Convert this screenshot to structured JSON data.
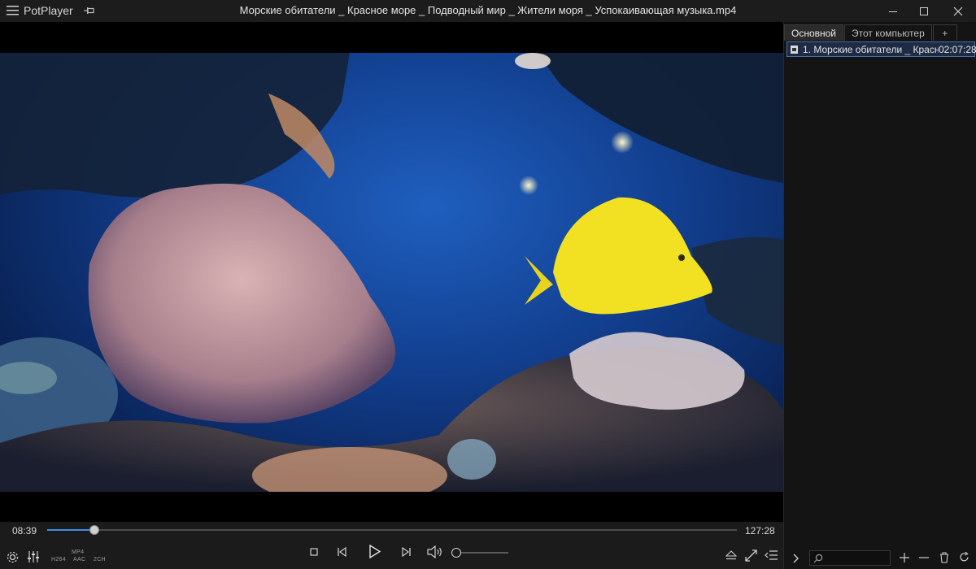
{
  "app": {
    "name": "PotPlayer",
    "title": "Морские обитатели _ Красное море _ Подводный мир _ Жители моря _ Успокаивающая музыка.mp4"
  },
  "icons": {
    "menu": "hamburger-icon",
    "pin": "pin-icon",
    "minimize": "minimize-icon",
    "maximize": "maximize-icon",
    "close": "close-icon"
  },
  "playlist": {
    "tabs": [
      {
        "label": "Основной",
        "active": true
      },
      {
        "label": "Этот компьютер",
        "active": false
      },
      {
        "label": "+",
        "active": false
      }
    ],
    "items": [
      {
        "name": "1. Морские обитатели _ Красно…",
        "duration": "02:07:28"
      }
    ]
  },
  "player": {
    "current_time": "08:39",
    "total_time": "127:28",
    "progress": 0.068,
    "volume": 0.0,
    "codecs": {
      "video": "H264",
      "container": "MP4",
      "audio": "AAC",
      "channels": "2CH"
    }
  },
  "colors": {
    "accent": "#3d8ee6",
    "background": "#1b1b1b",
    "selection": "#1e2b44"
  }
}
